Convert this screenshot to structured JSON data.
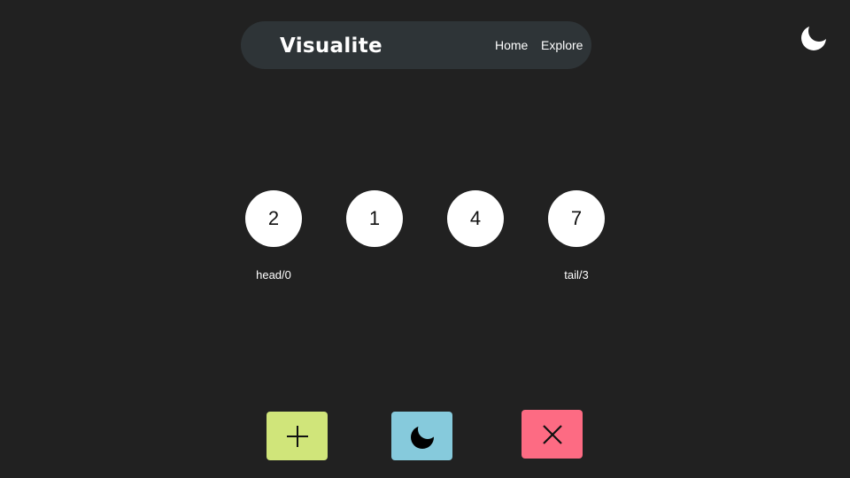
{
  "navbar": {
    "brand": "Visualite",
    "links": [
      "Home",
      "Explore"
    ]
  },
  "theme_toggle": {
    "icon": "moon-icon"
  },
  "linked_list": {
    "nodes": [
      "2",
      "1",
      "4",
      "7"
    ],
    "head_label": "head/0",
    "tail_label": "tail/3"
  },
  "actions": [
    {
      "icon": "plus-icon",
      "color": "#d0e57a"
    },
    {
      "icon": "moon-icon",
      "color": "#86cadc"
    },
    {
      "icon": "close-icon",
      "color": "#fd6b83"
    }
  ],
  "colors": {
    "background": "#212121",
    "navbar": "#2e3437",
    "node": "#ffffff"
  }
}
